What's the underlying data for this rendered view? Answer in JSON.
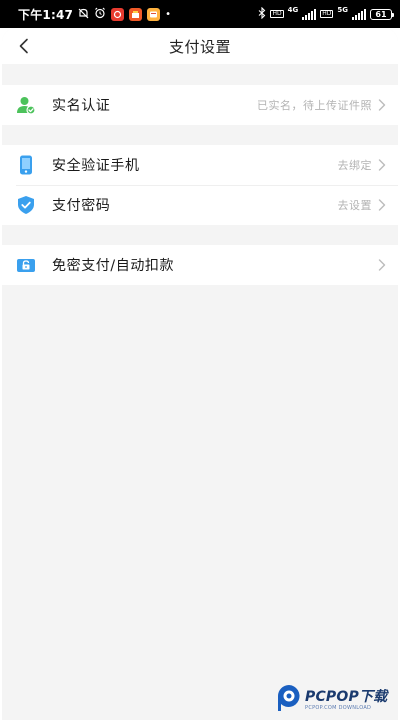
{
  "status_bar": {
    "time": "下午1:47",
    "battery": "61"
  },
  "header": {
    "title": "支付设置"
  },
  "groups": [
    {
      "items": [
        {
          "label": "实名认证",
          "value": "已实名，待上传证件照",
          "icon": "user-verified-icon"
        }
      ]
    },
    {
      "items": [
        {
          "label": "安全验证手机",
          "value": "去绑定",
          "icon": "phone-icon"
        },
        {
          "label": "支付密码",
          "value": "去设置",
          "icon": "shield-check-icon"
        }
      ]
    },
    {
      "items": [
        {
          "label": "免密支付/自动扣款",
          "value": "",
          "icon": "unlock-icon"
        }
      ]
    }
  ],
  "watermark": {
    "text": "PCPOP下载",
    "sub": "PCPOP.COM DOWNLOAD"
  },
  "colors": {
    "green_icon": "#4cc25b",
    "blue_icon": "#3aa0ee",
    "chevron": "#bcbcbc",
    "page_bg": "#f4f4f4"
  }
}
